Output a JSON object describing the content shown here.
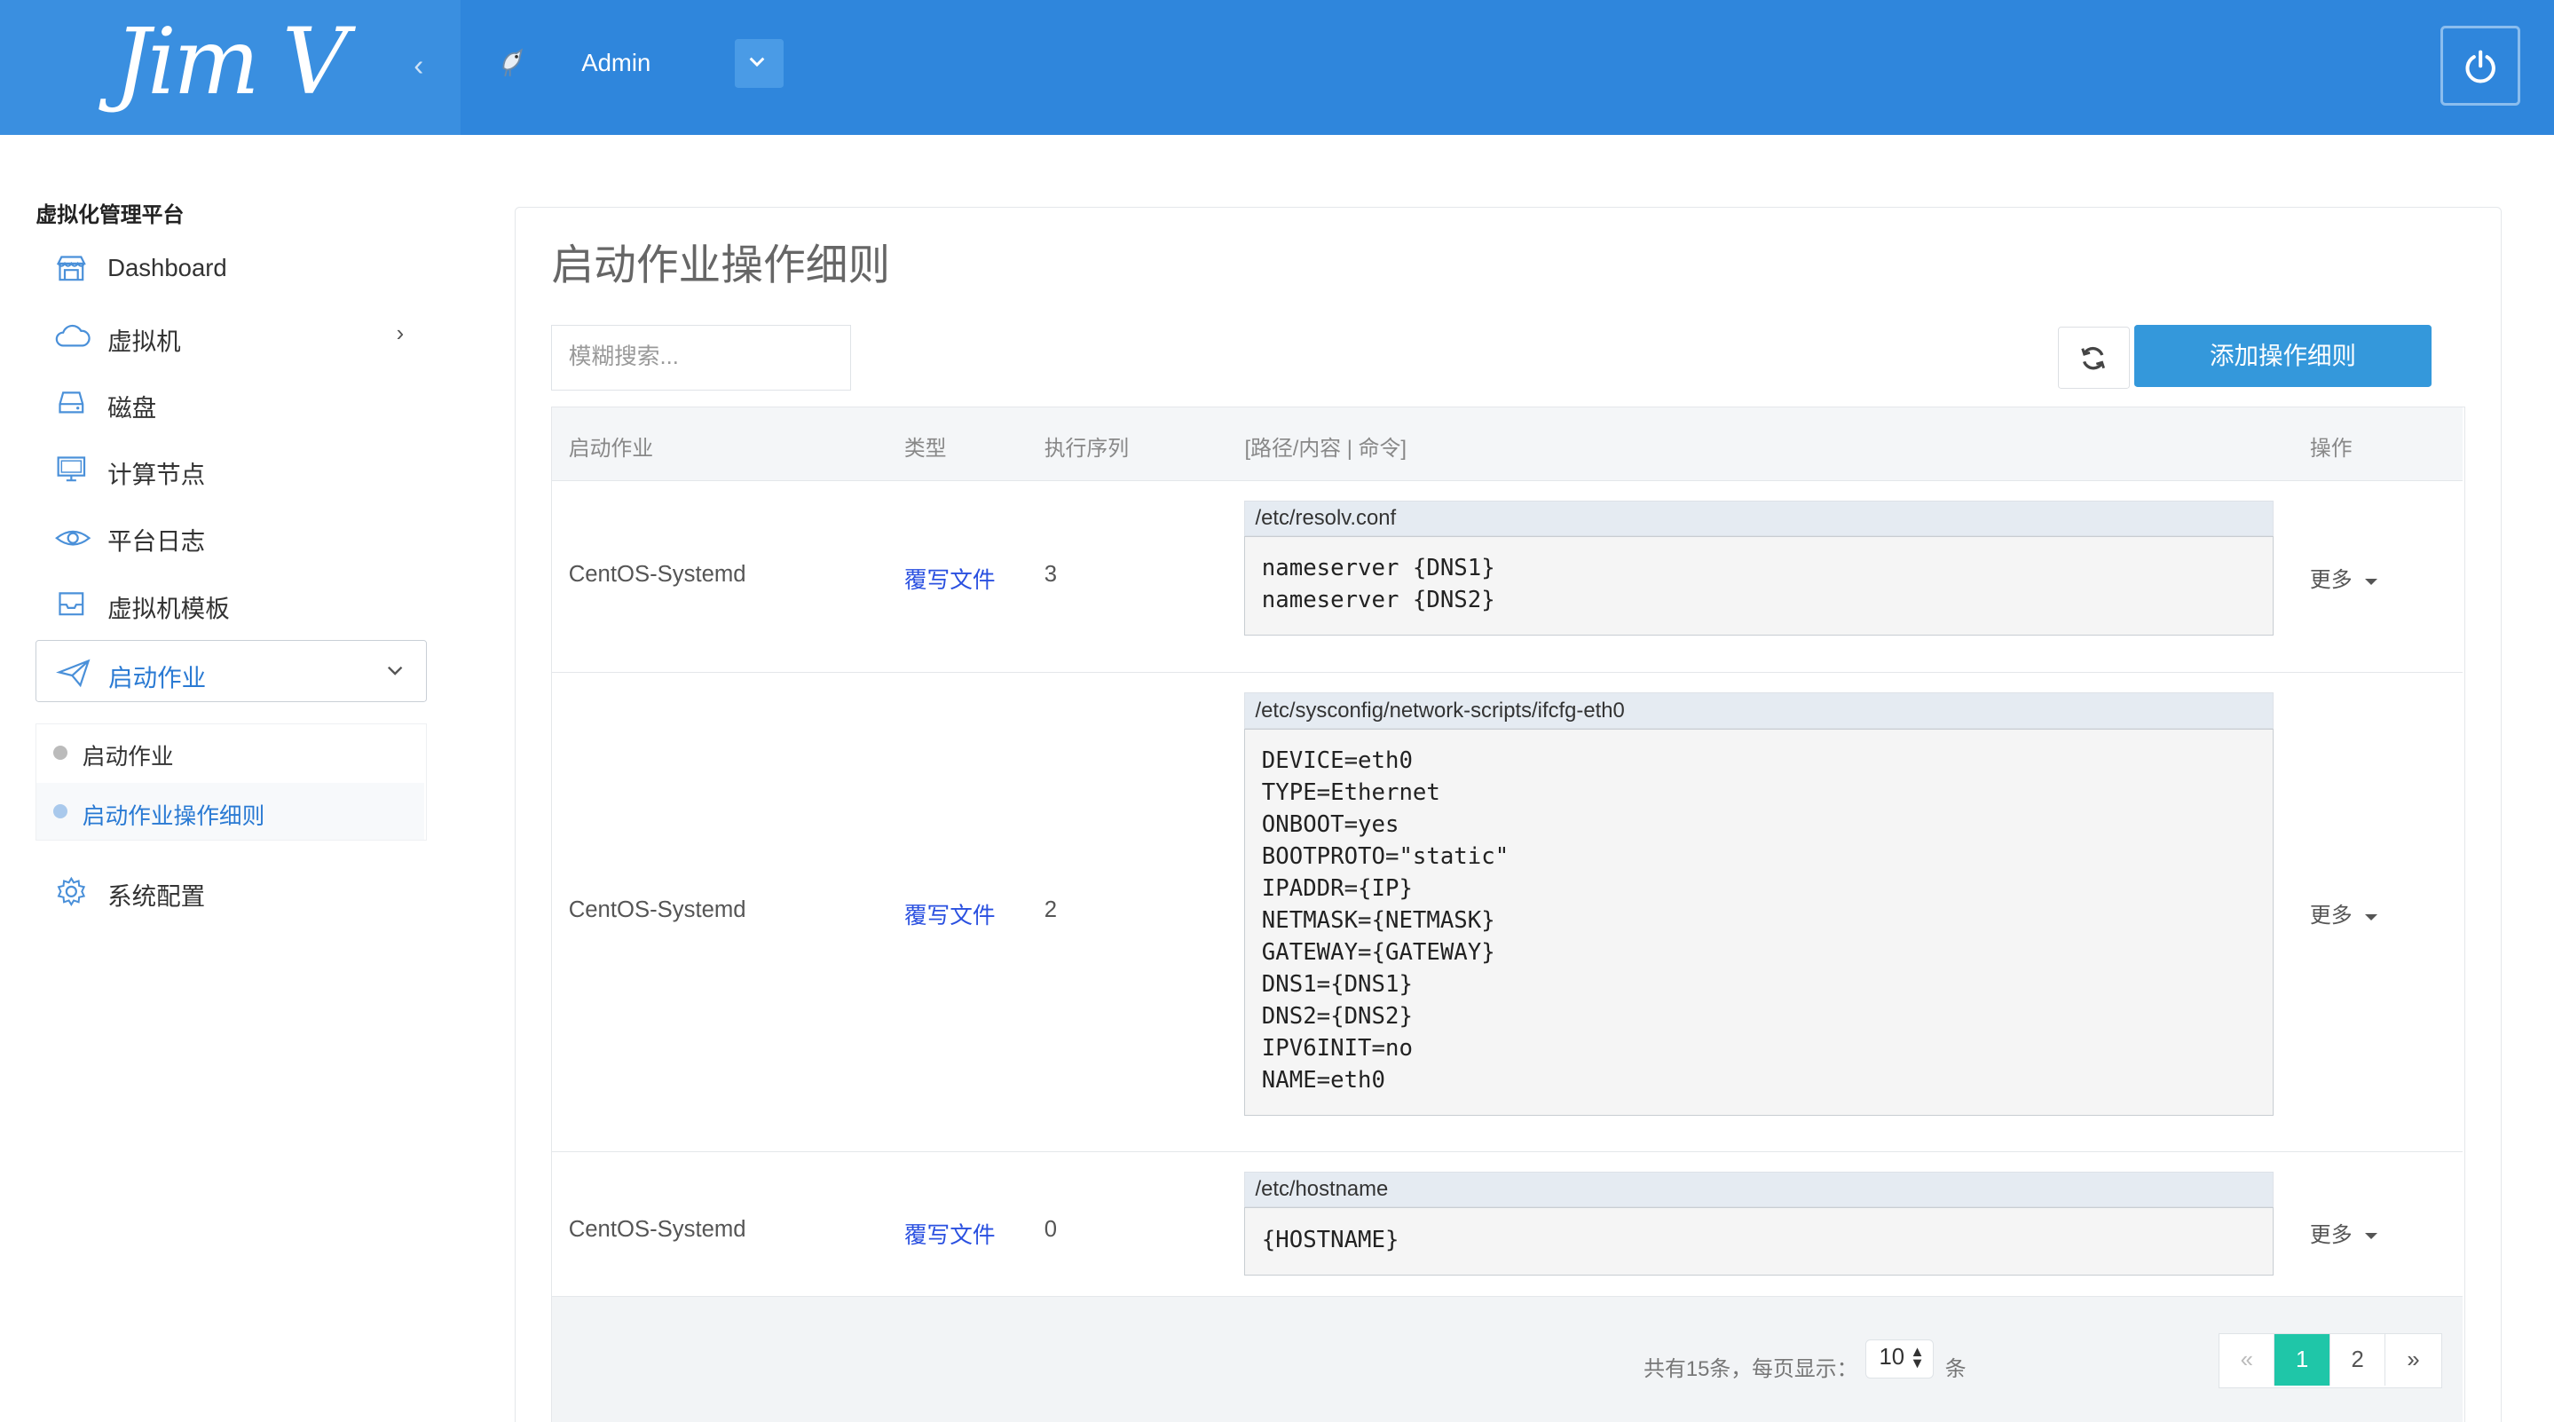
{
  "header": {
    "logo_text": "Jim V",
    "collapse_icon": "chevron-left-icon",
    "user_name": "Admin",
    "user_dropdown_icon": "chevron-down-icon",
    "logout_icon": "power-icon",
    "brand_color": "#2f86dc"
  },
  "sidebar": {
    "title": "虚拟化管理平台",
    "items": [
      {
        "label": "Dashboard",
        "icon": "store-icon"
      },
      {
        "label": "虚拟机",
        "icon": "cloud-icon",
        "has_children": true
      },
      {
        "label": "磁盘",
        "icon": "hard-drive-icon"
      },
      {
        "label": "计算节点",
        "icon": "monitor-icon"
      },
      {
        "label": "平台日志",
        "icon": "eye-icon"
      },
      {
        "label": "虚拟机模板",
        "icon": "inbox-icon"
      },
      {
        "label": "启动作业",
        "icon": "paper-plane-icon",
        "expanded": true
      },
      {
        "label": "系统配置",
        "icon": "gear-icon"
      }
    ],
    "sub_items": [
      {
        "label": "启动作业",
        "selected": false
      },
      {
        "label": "启动作业操作细则",
        "selected": true
      }
    ]
  },
  "main": {
    "title": "启动作业操作细则",
    "search_placeholder": "模糊搜索...",
    "refresh_icon": "refresh-icon",
    "add_button": "添加操作细则",
    "columns": [
      "启动作业",
      "类型",
      "执行序列",
      "[路径/内容 | 命令]",
      "操作"
    ],
    "rows": [
      {
        "job": "CentOS-Systemd",
        "type": "覆写文件",
        "seq": "3",
        "path": "/etc/resolv.conf",
        "content": "nameserver {DNS1}\nnameserver {DNS2}",
        "action": "更多"
      },
      {
        "job": "CentOS-Systemd",
        "type": "覆写文件",
        "seq": "2",
        "path": "/etc/sysconfig/network-scripts/ifcfg-eth0",
        "content": "DEVICE=eth0\nTYPE=Ethernet\nONBOOT=yes\nBOOTPROTO=\"static\"\nIPADDR={IP}\nNETMASK={NETMASK}\nGATEWAY={GATEWAY}\nDNS1={DNS1}\nDNS2={DNS2}\nIPV6INIT=no\nNAME=eth0",
        "action": "更多"
      },
      {
        "job": "CentOS-Systemd",
        "type": "覆写文件",
        "seq": "0",
        "path": "/etc/hostname",
        "content": "{HOSTNAME}",
        "action": "更多"
      }
    ],
    "footer": {
      "total_text": "共有15条，每页显示：",
      "page_size": "10",
      "unit": "条",
      "pages": [
        "«",
        "1",
        "2",
        "»"
      ],
      "current_page": "1",
      "accent": "#1fc6a8"
    }
  }
}
